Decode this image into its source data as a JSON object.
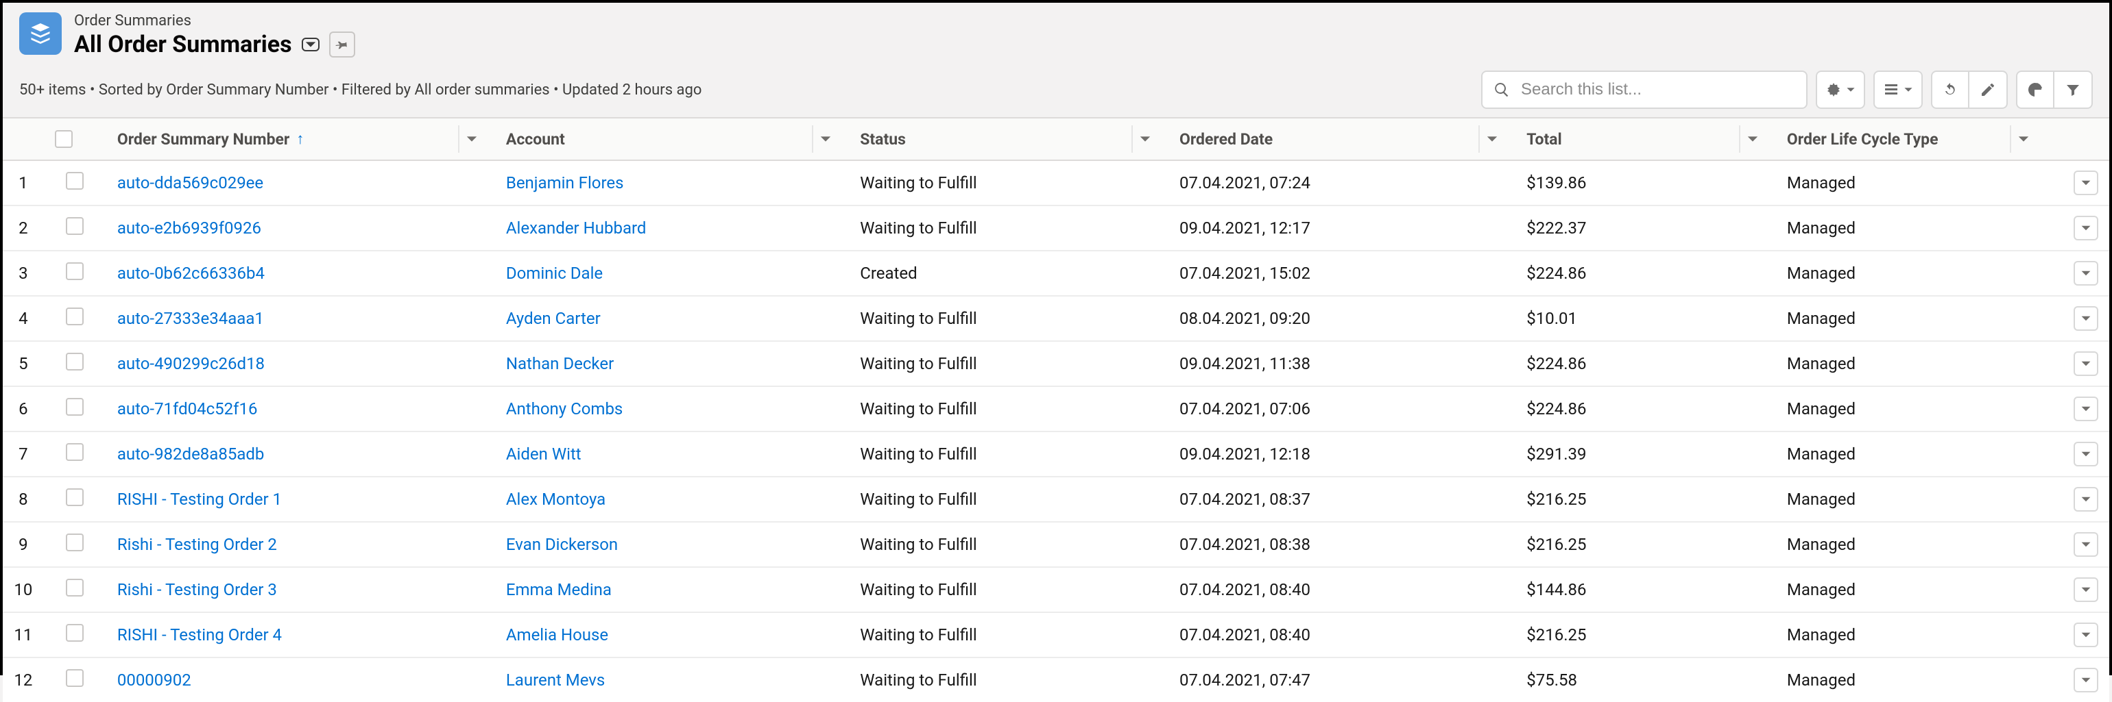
{
  "header": {
    "object_label": "Order Summaries",
    "view_name": "All Order Summaries"
  },
  "status_line": "50+ items • Sorted by Order Summary Number • Filtered by All order summaries • Updated 2 hours ago",
  "search": {
    "placeholder": "Search this list..."
  },
  "columns": {
    "order_summary_number": "Order Summary Number",
    "account": "Account",
    "status": "Status",
    "ordered_date": "Ordered Date",
    "total": "Total",
    "life_cycle": "Order Life Cycle Type"
  },
  "rows": [
    {
      "n": "1",
      "osn": "auto-dda569c029ee",
      "acct": "Benjamin Flores",
      "status": "Waiting to Fulfill",
      "date": "07.04.2021, 07:24",
      "total": "$139.86",
      "life": "Managed"
    },
    {
      "n": "2",
      "osn": "auto-e2b6939f0926",
      "acct": "Alexander Hubbard",
      "status": "Waiting to Fulfill",
      "date": "09.04.2021, 12:17",
      "total": "$222.37",
      "life": "Managed"
    },
    {
      "n": "3",
      "osn": "auto-0b62c66336b4",
      "acct": "Dominic Dale",
      "status": "Created",
      "date": "07.04.2021, 15:02",
      "total": "$224.86",
      "life": "Managed"
    },
    {
      "n": "4",
      "osn": "auto-27333e34aaa1",
      "acct": "Ayden Carter",
      "status": "Waiting to Fulfill",
      "date": "08.04.2021, 09:20",
      "total": "$10.01",
      "life": "Managed"
    },
    {
      "n": "5",
      "osn": "auto-490299c26d18",
      "acct": "Nathan Decker",
      "status": "Waiting to Fulfill",
      "date": "09.04.2021, 11:38",
      "total": "$224.86",
      "life": "Managed"
    },
    {
      "n": "6",
      "osn": "auto-71fd04c52f16",
      "acct": "Anthony Combs",
      "status": "Waiting to Fulfill",
      "date": "07.04.2021, 07:06",
      "total": "$224.86",
      "life": "Managed"
    },
    {
      "n": "7",
      "osn": "auto-982de8a85adb",
      "acct": "Aiden Witt",
      "status": "Waiting to Fulfill",
      "date": "09.04.2021, 12:18",
      "total": "$291.39",
      "life": "Managed"
    },
    {
      "n": "8",
      "osn": "RISHI - Testing Order 1",
      "acct": "Alex Montoya",
      "status": "Waiting to Fulfill",
      "date": "07.04.2021, 08:37",
      "total": "$216.25",
      "life": "Managed"
    },
    {
      "n": "9",
      "osn": "Rishi - Testing Order 2",
      "acct": "Evan Dickerson",
      "status": "Waiting to Fulfill",
      "date": "07.04.2021, 08:38",
      "total": "$216.25",
      "life": "Managed"
    },
    {
      "n": "10",
      "osn": "Rishi - Testing Order 3",
      "acct": "Emma Medina",
      "status": "Waiting to Fulfill",
      "date": "07.04.2021, 08:40",
      "total": "$144.86",
      "life": "Managed"
    },
    {
      "n": "11",
      "osn": "RISHI - Testing Order 4",
      "acct": "Amelia House",
      "status": "Waiting to Fulfill",
      "date": "07.04.2021, 08:40",
      "total": "$216.25",
      "life": "Managed"
    },
    {
      "n": "12",
      "osn": "00000902",
      "acct": "Laurent Mevs",
      "status": "Waiting to Fulfill",
      "date": "07.04.2021, 07:47",
      "total": "$75.58",
      "life": "Managed"
    }
  ]
}
